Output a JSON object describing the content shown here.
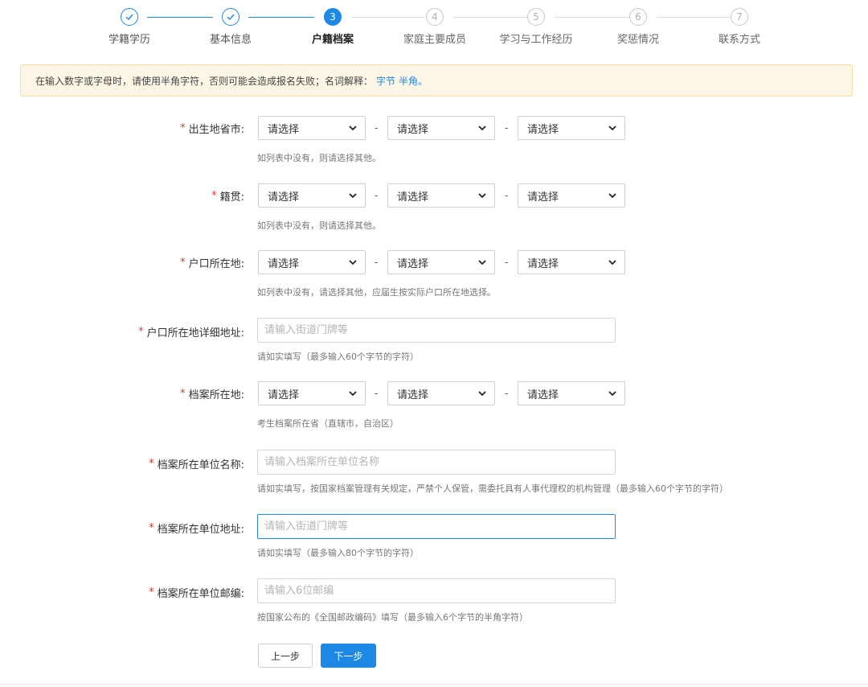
{
  "steps": [
    {
      "number": "1",
      "label": "学籍学历",
      "state": "done"
    },
    {
      "number": "2",
      "label": "基本信息",
      "state": "done"
    },
    {
      "number": "3",
      "label": "户籍档案",
      "state": "active"
    },
    {
      "number": "4",
      "label": "家庭主要成员",
      "state": "pending"
    },
    {
      "number": "5",
      "label": "学习与工作经历",
      "state": "pending"
    },
    {
      "number": "6",
      "label": "奖惩情况",
      "state": "pending"
    },
    {
      "number": "7",
      "label": "联系方式",
      "state": "pending"
    }
  ],
  "notice": {
    "text": "在输入数字或字母时，请使用半角字符，否则可能会造成报名失败；名词解释：",
    "link_byte": "字节",
    "link_halfwidth": "半角。"
  },
  "form": {
    "required_mark": "*",
    "separator": "-",
    "select_placeholder": "请选择",
    "birthplace": {
      "label": "出生地省市:",
      "hint": "如列表中没有，则请选择其他。"
    },
    "native_place": {
      "label": "籍贯:",
      "hint": "如列表中没有，则请选择其他。"
    },
    "household_location": {
      "label": "户口所在地:",
      "hint": "如列表中没有，请选择其他，应届生按实际户口所在地选择。"
    },
    "household_address": {
      "label": "户口所在地详细地址:",
      "placeholder": "请输入街道门牌等",
      "value": "",
      "hint": "请如实填写（最多输入60个字节的字符）"
    },
    "archive_location": {
      "label": "档案所在地:",
      "hint": "考生档案所在省（直辖市，自治区）"
    },
    "archive_unit_name": {
      "label": "档案所在单位名称:",
      "placeholder": "请输入档案所在单位名称",
      "value": "",
      "hint": "请如实填写，按国家档案管理有关规定，严禁个人保管，需委托具有人事代理权的机构管理（最多输入60个字节的字符）"
    },
    "archive_unit_address": {
      "label": "档案所在单位地址:",
      "placeholder": "请输入街道门牌等",
      "value": "",
      "hint": "请如实填写（最多输入80个字节的字符）"
    },
    "archive_unit_postcode": {
      "label": "档案所在单位邮编:",
      "placeholder": "请输入6位邮编",
      "value": "",
      "hint": "按国家公布的《全国邮政编码》填写（最多输入6个字节的半角字符）"
    }
  },
  "buttons": {
    "prev": "上一步",
    "next": "下一步"
  },
  "colors": {
    "accent": "#1e88e5",
    "required": "#e53935",
    "notice_bg": "#fdf6e7",
    "notice_border": "#f5dca9"
  },
  "icons": {
    "done_step": "check-icon",
    "dropdown": "chevron-down-icon"
  }
}
